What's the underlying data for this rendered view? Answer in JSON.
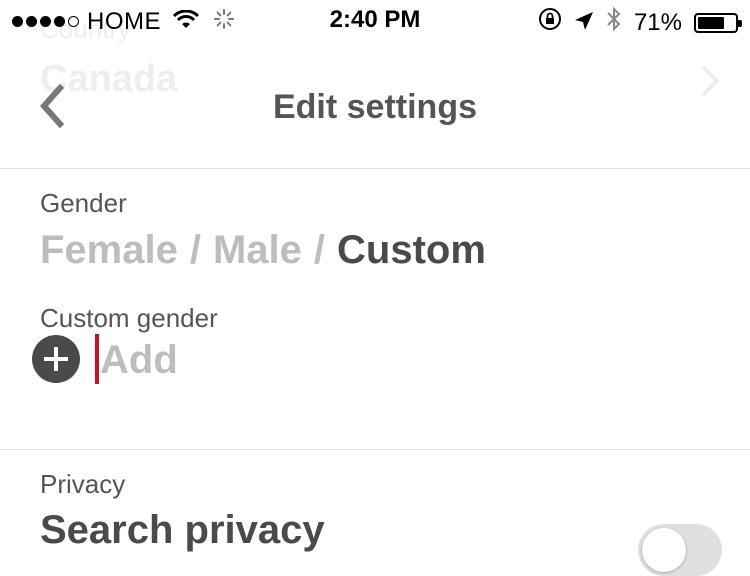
{
  "status_bar": {
    "carrier": "HOME",
    "time": "2:40 PM",
    "battery_percent": "71%",
    "battery_level": 0.71,
    "signal_bars_filled": 4,
    "signal_bars_total": 5,
    "icons": [
      "wifi-icon",
      "loading-spinner-icon",
      "rotation-lock-icon",
      "location-arrow-icon",
      "bluetooth-icon",
      "battery-icon"
    ]
  },
  "background_row": {
    "label": "Country",
    "value": "Canada"
  },
  "nav": {
    "title": "Edit settings",
    "back_icon": "chevron-left-icon"
  },
  "gender": {
    "label": "Gender",
    "options": [
      "Female",
      "Male",
      "Custom"
    ],
    "separator": "/",
    "selected": "Custom"
  },
  "custom_gender": {
    "label": "Custom gender",
    "placeholder": "Add",
    "value": "",
    "add_icon": "plus-circle-icon"
  },
  "privacy": {
    "label": "Privacy",
    "search_privacy_title": "Search privacy",
    "search_privacy_enabled": false
  },
  "colors": {
    "caret": "#c8102e",
    "selected_text": "#4a4a4a",
    "unselected_text": "#bdbdbd"
  }
}
